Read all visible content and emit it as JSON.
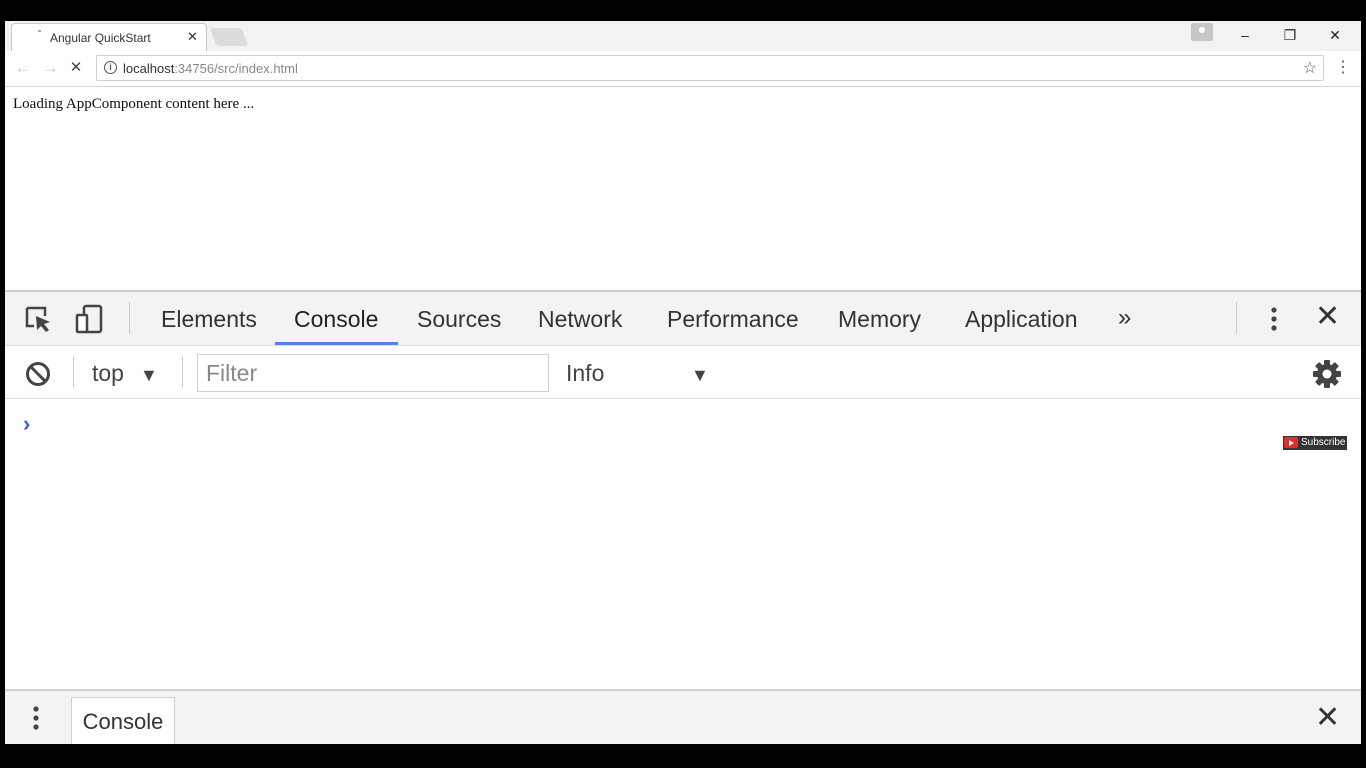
{
  "browser": {
    "tab_title": "Angular QuickStart",
    "tab_close": "✕",
    "url_host": "localhost",
    "url_path": ":34756/src/index.html",
    "window_controls": {
      "minimize": "–",
      "restore": "❐",
      "close": "✕"
    },
    "icons": {
      "back": "back-arrow-icon",
      "forward": "forward-arrow-icon",
      "stop": "stop-loading-icon",
      "star": "bookmark-star-icon",
      "menu": "menu-dots-icon"
    }
  },
  "page": {
    "loading_text": "Loading AppComponent content here ..."
  },
  "devtools": {
    "tabs": [
      {
        "label": "Elements",
        "active": false
      },
      {
        "label": "Console",
        "active": true
      },
      {
        "label": "Sources",
        "active": false
      },
      {
        "label": "Network",
        "active": false
      },
      {
        "label": "Performance",
        "active": false
      },
      {
        "label": "Memory",
        "active": false
      },
      {
        "label": "Application",
        "active": false
      }
    ],
    "more_tabs": "»",
    "close": "✕",
    "accent_color": "#5a7de8",
    "console": {
      "context": "top",
      "filter_placeholder": "Filter",
      "level": "Info",
      "prompt": "›"
    },
    "drawer": {
      "tab_label": "Console",
      "close": "✕"
    }
  },
  "overlay": {
    "subscribe_label": "Subscribe"
  }
}
